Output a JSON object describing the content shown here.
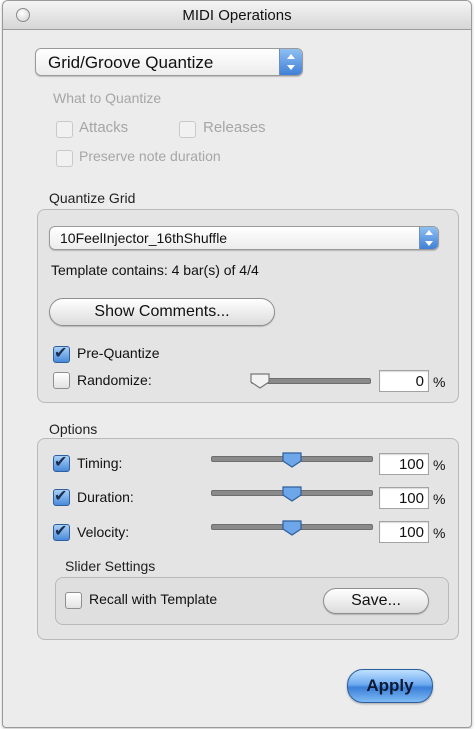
{
  "window": {
    "title": "MIDI Operations"
  },
  "operation_popup": {
    "value": "Grid/Groove Quantize"
  },
  "what_to_quantize": {
    "label": "What to Quantize",
    "attacks": "Attacks",
    "releases": "Releases",
    "preserve": "Preserve note duration"
  },
  "quantize_grid": {
    "label": "Quantize Grid",
    "template_popup": "10FeelInjector_16thShuffle",
    "template_info": "Template contains: 4 bar(s) of 4/4",
    "show_comments": "Show Comments...",
    "pre_quantize": {
      "label": "Pre-Quantize",
      "checked": true
    },
    "randomize": {
      "label": "Randomize:",
      "checked": false,
      "value": "0",
      "level": 0
    }
  },
  "options": {
    "label": "Options",
    "rows": [
      {
        "label": "Timing:",
        "checked": true,
        "value": "100",
        "level": 100
      },
      {
        "label": "Duration:",
        "checked": true,
        "value": "100",
        "level": 100
      },
      {
        "label": "Velocity:",
        "checked": true,
        "value": "100",
        "level": 100
      }
    ],
    "unit": "%",
    "slider_settings": {
      "label": "Slider Settings",
      "recall": "Recall with Template",
      "save": "Save..."
    }
  },
  "apply_label": "Apply"
}
